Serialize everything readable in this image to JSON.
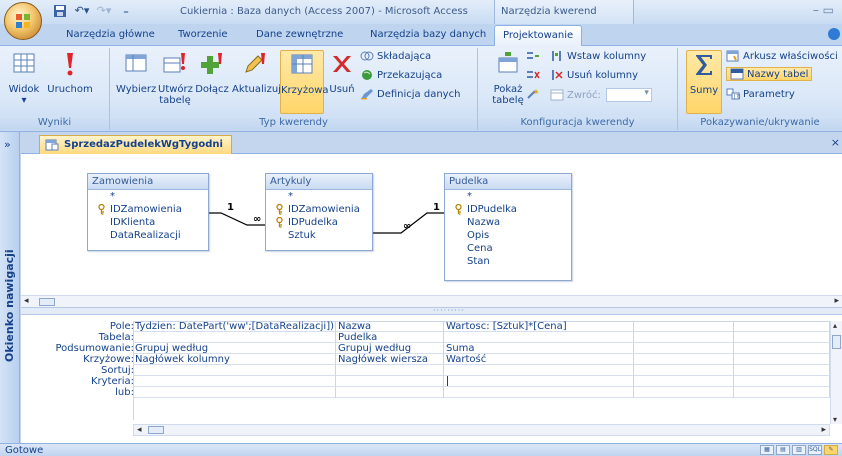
{
  "window": {
    "title": "Cukiernia : Baza danych (Access 2007) - Microsoft Access",
    "context_group": "Narzędzia kwerend"
  },
  "tabs": [
    "Narzędzia główne",
    "Tworzenie",
    "Dane zewnętrzne",
    "Narzędzia bazy danych",
    "Projektowanie"
  ],
  "ribbon": {
    "results": {
      "label": "Wyniki",
      "view": "Widok",
      "run": "Uruchom"
    },
    "query_type": {
      "label": "Typ kwerendy",
      "select": "Wybierz",
      "make_table_1": "Utwórz",
      "make_table_2": "tabelę",
      "append": "Dołącz",
      "update": "Aktualizuj",
      "crosstab": "Krzyżowa",
      "delete": "Usuń",
      "union": "Składająca",
      "pass_through": "Przekazująca",
      "data_definition": "Definicja danych"
    },
    "query_setup": {
      "label": "Konfiguracja kwerendy",
      "show_table_1": "Pokaż",
      "show_table_2": "tabelę",
      "insert_columns": "Wstaw kolumny",
      "delete_columns": "Usuń kolumny",
      "return": "Zwróć:"
    },
    "show_hide": {
      "label": "Pokazywanie/ukrywanie",
      "totals": "Sumy",
      "property_sheet": "Arkusz właściwości",
      "table_names": "Nazwy tabel",
      "parameters": "Parametry"
    }
  },
  "nav": {
    "label": "Okienko nawigacji",
    "toggle": "»"
  },
  "document": {
    "tab": "SprzedazPudelekWgTygodni",
    "close": "×",
    "tables": [
      {
        "name": "Zamowienia",
        "fields": [
          "*",
          "IDZamowienia",
          "IDKlienta",
          "DataRealizacji"
        ],
        "keys": [
          1
        ]
      },
      {
        "name": "Artykuly",
        "fields": [
          "*",
          "IDZamowienia",
          "IDPudelka",
          "Sztuk"
        ],
        "keys": [
          1,
          2
        ]
      },
      {
        "name": "Pudelka",
        "fields": [
          "*",
          "IDPudelka",
          "Nazwa",
          "Opis",
          "Cena",
          "Stan"
        ],
        "keys": [
          1
        ]
      }
    ],
    "relations": [
      {
        "one": "1",
        "many": "∞"
      },
      {
        "one": "1",
        "many": "∞"
      }
    ]
  },
  "grid": {
    "row_labels": [
      "Pole:",
      "Tabela:",
      "Podsumowanie:",
      "Krzyżowe:",
      "Sortuj:",
      "Kryteria:",
      "lub:"
    ],
    "columns": [
      [
        "Tydzien: DatePart('ww';[DataRealizacji])",
        "",
        "Grupuj według",
        "Nagłówek kolumny",
        "",
        "",
        ""
      ],
      [
        "Nazwa",
        "Pudelka",
        "Grupuj według",
        "Nagłówek wiersza",
        "",
        "",
        ""
      ],
      [
        "Wartosc: [Sztuk]*[Cena]",
        "",
        "Suma",
        "Wartość",
        "",
        "",
        ""
      ],
      [
        "",
        "",
        "",
        "",
        "",
        "",
        ""
      ],
      [
        "",
        "",
        "",
        "",
        "",
        "",
        ""
      ]
    ]
  },
  "status": {
    "text": "Gotowe"
  },
  "colors": {
    "selected": "#ffd56a",
    "ribbon_text": "#15428b",
    "tab_highlight": "#ffd980"
  }
}
